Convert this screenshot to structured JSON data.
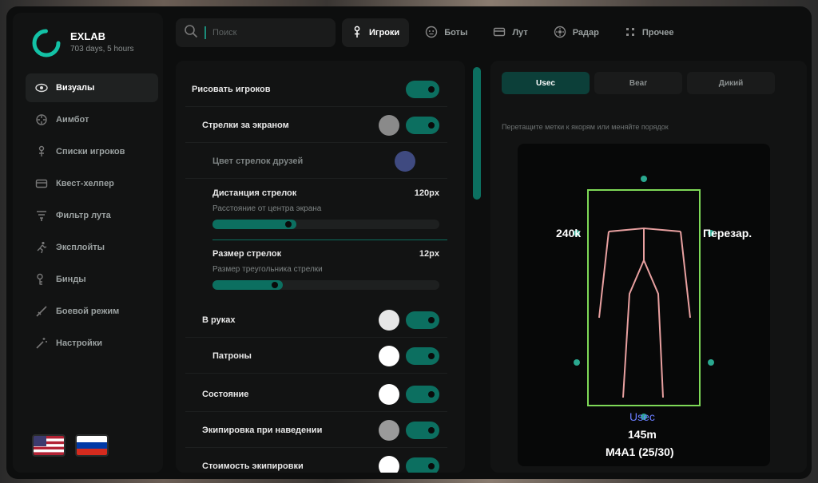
{
  "app": {
    "title": "EXLAB",
    "subtitle": "703 days, 5 hours"
  },
  "sidebar": {
    "items": [
      {
        "label": "Визуалы",
        "icon": "eye-icon",
        "active": true
      },
      {
        "label": "Аимбот",
        "icon": "crosshair-icon"
      },
      {
        "label": "Списки игроков",
        "icon": "person-icon"
      },
      {
        "label": "Квест-хелпер",
        "icon": "card-icon"
      },
      {
        "label": "Фильтр лута",
        "icon": "filter-icon"
      },
      {
        "label": "Эксплойты",
        "icon": "running-man-icon"
      },
      {
        "label": "Бинды",
        "icon": "key-icon"
      },
      {
        "label": "Боевой режим",
        "icon": "sword-icon"
      },
      {
        "label": "Настройки",
        "icon": "magic-wand-icon"
      }
    ],
    "languages": [
      "us-flag-icon",
      "ru-flag-icon"
    ]
  },
  "search": {
    "placeholder": "Поиск"
  },
  "tabs": [
    {
      "label": "Игроки",
      "icon": "person-icon",
      "active": true
    },
    {
      "label": "Боты",
      "icon": "bot-face-icon"
    },
    {
      "label": "Лут",
      "icon": "card-icon"
    },
    {
      "label": "Радар",
      "icon": "radar-icon"
    },
    {
      "label": "Прочее",
      "icon": "dots-icon"
    }
  ],
  "settings": {
    "draw_players": "Рисовать игроков",
    "offscreen_arrows": "Стрелки за экраном",
    "friend_arrow_color": "Цвет стрелок друзей",
    "arrow_distance": {
      "title": "Дистанция стрелок",
      "value": "120px",
      "desc": "Расстояние от центра экрана",
      "fraction": 0.37
    },
    "arrow_size": {
      "title": "Размер стрелок",
      "value": "12px",
      "desc": "Размер треугольника стрелки",
      "fraction": 0.31
    },
    "in_hands": "В руках",
    "ammo": "Патроны",
    "state": "Состояние",
    "gear_on_hover": "Экипировка при наведении",
    "gear_value": "Стоимость экипировки"
  },
  "colors": {
    "accent": "#0c6f60",
    "arrow_color_swatch": "#8a8a8a",
    "friend_color_swatch": "#3f4a80",
    "white_swatch": "#ffffff",
    "box_color": "#7ed957",
    "skeleton_color": "#e8a0a0",
    "faction_text": "#6a7dff"
  },
  "preview": {
    "tabs": [
      {
        "label": "Usec",
        "active": true
      },
      {
        "label": "Bear"
      },
      {
        "label": "Дикий"
      }
    ],
    "hint": "Перетащите метки к якорям или меняйте порядок",
    "left_label": "240k",
    "right_label": "Перезар.",
    "faction": "Usec",
    "distance": "145m",
    "weapon": "M4A1 (25/30)"
  }
}
